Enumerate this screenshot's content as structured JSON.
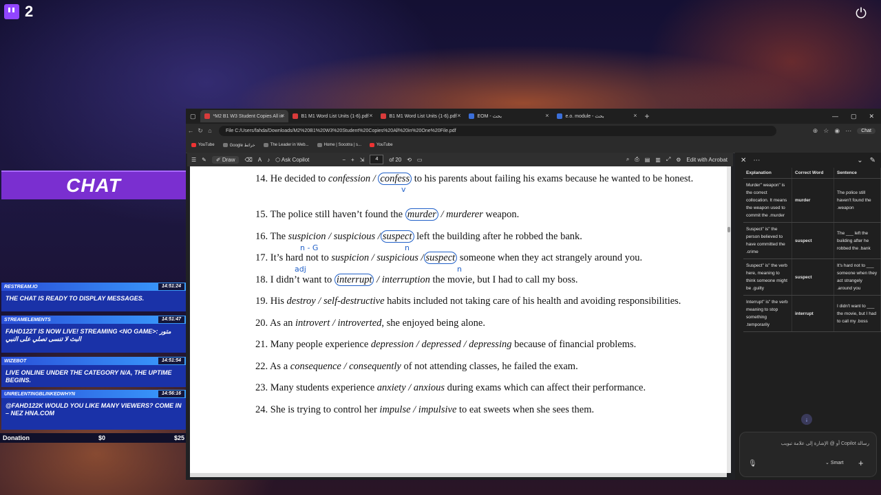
{
  "stream": {
    "viewer_count": "2",
    "chat_title": "CHAT",
    "messages": [
      {
        "source": "RESTREAM.IO",
        "time": "14:51:24",
        "text": "THE CHAT IS READY TO DISPLAY MESSAGES."
      },
      {
        "source": "STREAMELEMENTS",
        "time": "14:51:47",
        "text": "FAHD122T IS NOW LIVE! STREAMING <NO GAME>: متور البث لا تنسى تصلي على النبي"
      },
      {
        "source": "WIZEBOT",
        "time": "14:51:54",
        "text": "LIVE ONLINE UNDER THE CATEGORY N/A, THE UPTIME BEGINS."
      },
      {
        "source": "UNRELENTINGBLINKEDWHYN",
        "time": "14:56:16",
        "text": "@FAHD122K WOULD YOU LIKE MANY VIEWERS? COME IN – NEZ HNA.COM"
      }
    ],
    "donation": {
      "label": "Donation",
      "current": "$0",
      "goal": "$25"
    }
  },
  "browser": {
    "tabs": [
      {
        "label": "*M2 B1 W3 Student Copies All in",
        "active": true
      },
      {
        "label": "B1 M1 Word List Units (1-6).pdf",
        "active": false
      },
      {
        "label": "B1 M1 Word List Units (1-6).pdf",
        "active": false
      },
      {
        "label": "EOM - بحث",
        "active": false
      },
      {
        "label": "e.o. module - بحث",
        "active": false
      }
    ],
    "address": "File   C:/Users/fahda/Downloads/M2%20B1%20W3%20Student%20Copies%20All%20in%20One%20File.pdf",
    "chat_button": "Chat",
    "bookmarks": [
      "YouTube",
      "Google خرائط",
      "The Leader in Web...",
      "Home | Socotra | s...",
      "YouTube"
    ]
  },
  "pdf_toolbar": {
    "draw": "Draw",
    "ask_copilot": "Ask Copilot",
    "page_current": "4",
    "page_total": "of 20",
    "edit": "Edit with Acrobat"
  },
  "questions": [
    {
      "num": "14.",
      "pre": "He decided to ",
      "opt1": "confession / ",
      "circled": "confess",
      "opt2": "",
      "post": " to his parents about failing his exams because he wanted to be honest."
    },
    {
      "num": "15.",
      "pre": "The police still haven’t found the ",
      "opt1": "",
      "circled": "murder",
      "opt2": " / murderer",
      "post": " weapon."
    },
    {
      "num": "16.",
      "pre": "The ",
      "opt1": "suspicion / suspicious /",
      "circled": "suspect",
      "opt2": "",
      "post": " left the building after he robbed the bank."
    },
    {
      "num": "17.",
      "pre": "It’s hard not to ",
      "opt1": "suspicion / suspicious /",
      "circled": "suspect",
      "opt2": "",
      "post": " someone when they act strangely around you."
    },
    {
      "num": "18.",
      "pre": "I didn’t want to ",
      "opt1": "",
      "circled": "interrupt",
      "opt2": " / interruption",
      "post": " the movie, but I had to call my boss."
    },
    {
      "num": "19.",
      "pre": "His ",
      "opt1": "destroy / self-destructive",
      "circled": "",
      "opt2": "",
      "post": " habits included not taking care of his health and avoiding responsibilities."
    },
    {
      "num": "20.",
      "pre": "As an ",
      "opt1": "introvert / introverted",
      "circled": "",
      "opt2": "",
      "post": ", she enjoyed being alone."
    },
    {
      "num": "21.",
      "pre": "Many people experience ",
      "opt1": "depression / depressed / depressing",
      "circled": "",
      "opt2": "",
      "post": " because of financial problems."
    },
    {
      "num": "22.",
      "pre": "As a ",
      "opt1": "consequence / consequently",
      "circled": "",
      "opt2": "",
      "post": " of not attending classes, he failed the exam."
    },
    {
      "num": "23.",
      "pre": "Many students experience ",
      "opt1": "anxiety / anxious",
      "circled": "",
      "opt2": "",
      "post": " during exams which can affect their performance."
    },
    {
      "num": "24.",
      "pre": "She is trying to control her ",
      "opt1": "impulse / impulsive",
      "circled": "",
      "opt2": "",
      "post": " to eat sweets when she sees them."
    }
  ],
  "annotations": {
    "n_g": "n - G",
    "adj": "adj",
    "n1": "n",
    "n2": "n",
    "v": "v"
  },
  "copilot": {
    "headers": [
      "Explanation",
      "Correct Word",
      "Sentence"
    ],
    "rows": [
      {
        "explanation": "Murder\" weapon\" is the correct collocation. It means the weapon used to commit the .murder",
        "word": "murder",
        "sentence": "The police still haven't found the .weapon"
      },
      {
        "explanation": "Suspect\" is\" the person believed to have committed the .crime",
        "word": "suspect",
        "sentence": "The ___ left the building after he robbed the .bank"
      },
      {
        "explanation": "Suspect\" is\" the verb here, meaning to think someone might be .guilty",
        "word": "suspect",
        "sentence": "It's hard not to ___ someone when they act strangely .around you"
      },
      {
        "explanation": "Interrupt\" is\" the verb meaning to stop something .temporarily",
        "word": "interrupt",
        "sentence": "I didn't want to ___ the movie, but I had to call my .boss"
      }
    ],
    "input_placeholder": "رسالة Copilot أو @ الإشارة إلى علامة تبويب",
    "mode": "Smart"
  }
}
